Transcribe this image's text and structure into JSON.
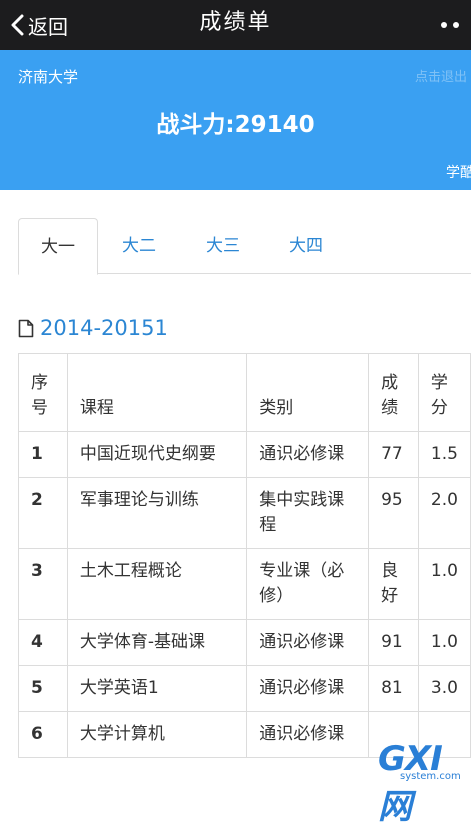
{
  "nav": {
    "back_label": "返回",
    "title": "成绩单"
  },
  "banner": {
    "school": "济南大学",
    "faded_text": "点击退出",
    "power": "战斗力:29140",
    "tag": "学酷"
  },
  "tabs": [
    {
      "label": "大一",
      "active": true
    },
    {
      "label": "大二",
      "active": false
    },
    {
      "label": "大三",
      "active": false
    },
    {
      "label": "大四",
      "active": false
    }
  ],
  "term": {
    "label": "2014-20151",
    "icon": "document-icon"
  },
  "table": {
    "headers": [
      "序号",
      "课程",
      "类别",
      "成绩",
      "学分"
    ],
    "rows": [
      {
        "no": "1",
        "course": "中国近现代史纲要",
        "category": "通识必修课",
        "score": "77",
        "credit": "1.5"
      },
      {
        "no": "2",
        "course": "军事理论与训练",
        "category": "集中实践课程",
        "score": "95",
        "credit": "2.0"
      },
      {
        "no": "3",
        "course": "土木工程概论",
        "category": "专业课（必修）",
        "score": "良好",
        "credit": "1.0"
      },
      {
        "no": "4",
        "course": "大学体育-基础课",
        "category": "通识必修课",
        "score": "91",
        "credit": "1.0"
      },
      {
        "no": "5",
        "course": "大学英语1",
        "category": "通识必修课",
        "score": "81",
        "credit": "3.0"
      },
      {
        "no": "6",
        "course": "大学计算机",
        "category": "通识必修课",
        "score": "",
        "credit": ""
      }
    ]
  },
  "watermark": {
    "brand": "GXI网",
    "site": "system.com"
  },
  "colors": {
    "nav_bg": "#1c1c1e",
    "banner_bg": "#3aa0f2",
    "link": "#2b86d3",
    "border": "#dcdcdc"
  }
}
